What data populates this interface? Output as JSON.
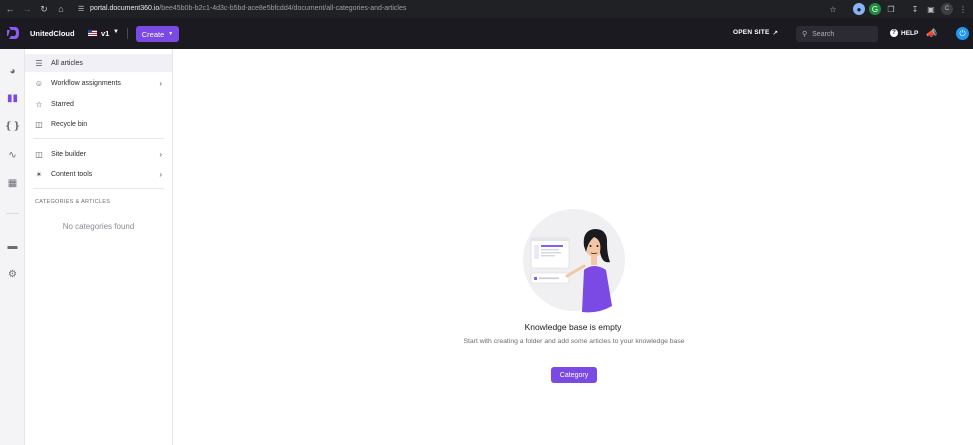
{
  "browser": {
    "url_host": "portal.document360.io",
    "url_path": "/bee45b0b-b2c1-4d3c-b5bd-ace8e5bfcdd4/document/all-categories-and-articles",
    "profile_initial": "C"
  },
  "header": {
    "project_name": "UnitedCloud",
    "version_label": "v1",
    "create_label": "Create",
    "open_site_label": "OPEN SITE",
    "search_placeholder": "Search",
    "help_label": "HELP"
  },
  "rail": {
    "items": [
      {
        "icon": "dashboard-icon"
      },
      {
        "icon": "documents-icon",
        "active": true
      },
      {
        "icon": "api-icon"
      },
      {
        "icon": "analytics-icon"
      },
      {
        "icon": "widgets-icon"
      },
      {
        "icon": "drive-icon"
      },
      {
        "icon": "settings-icon"
      }
    ]
  },
  "sidebar": {
    "items": [
      {
        "label": "All articles",
        "icon": "list-icon",
        "active": true
      },
      {
        "label": "Workflow assignments",
        "icon": "workflow-icon",
        "has_chevron": true
      },
      {
        "label": "Starred",
        "icon": "star-icon"
      },
      {
        "label": "Recycle bin",
        "icon": "trash-icon"
      },
      {
        "label": "Site builder",
        "icon": "site-builder-icon",
        "has_chevron": true
      },
      {
        "label": "Content tools",
        "icon": "content-tools-icon",
        "has_chevron": true
      }
    ],
    "section_title": "CATEGORIES & ARTICLES",
    "empty_text": "No categories found"
  },
  "main": {
    "empty_title": "Knowledge base is empty",
    "empty_description": "Start with creating a folder and add some articles to your knowledge base",
    "category_button_label": "Category"
  },
  "colors": {
    "accent": "#7b49e3",
    "app_bar": "#1b1a21",
    "browser_bar": "#202124"
  }
}
